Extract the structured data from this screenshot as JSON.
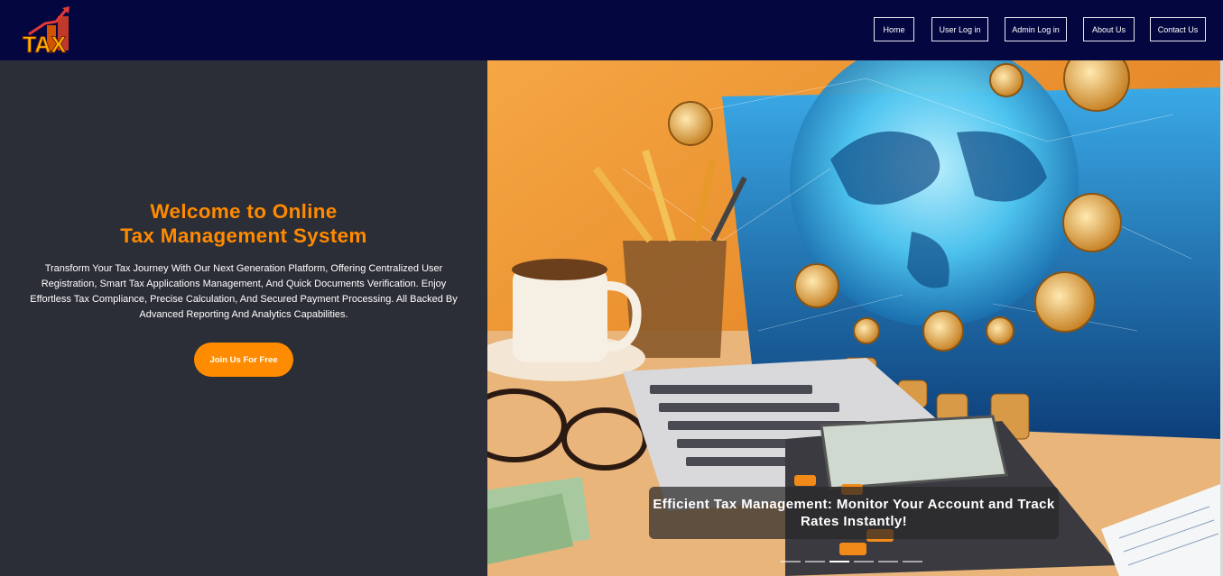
{
  "header": {
    "logo_text": "TAX",
    "nav": [
      {
        "label": "Home"
      },
      {
        "label": "User Log in"
      },
      {
        "label": "Admin Log in"
      },
      {
        "label": "About Us"
      },
      {
        "label": "Contact Us"
      }
    ]
  },
  "hero": {
    "title_line1": "Welcome to Online",
    "title_line2": "Tax Management System",
    "description": "Transform Your Tax Journey With Our Next Generation Platform, Offering Centralized User Registration, Smart Tax Applications Management, And Quick Documents Verification. Enjoy Effortless Tax Compliance, Precise Calculation, And Secured Payment Processing. All Backed By Advanced Reporting And Analytics Capabilities.",
    "cta_label": "Join Us For Free"
  },
  "carousel": {
    "caption": "Efficient Tax Management: Monitor Your Account and Track Rates Instantly!",
    "slide_count": 6,
    "active_slide": 2
  },
  "colors": {
    "topbar": "#040640",
    "accent": "#ff8c00",
    "panel": "#2b2e36"
  }
}
